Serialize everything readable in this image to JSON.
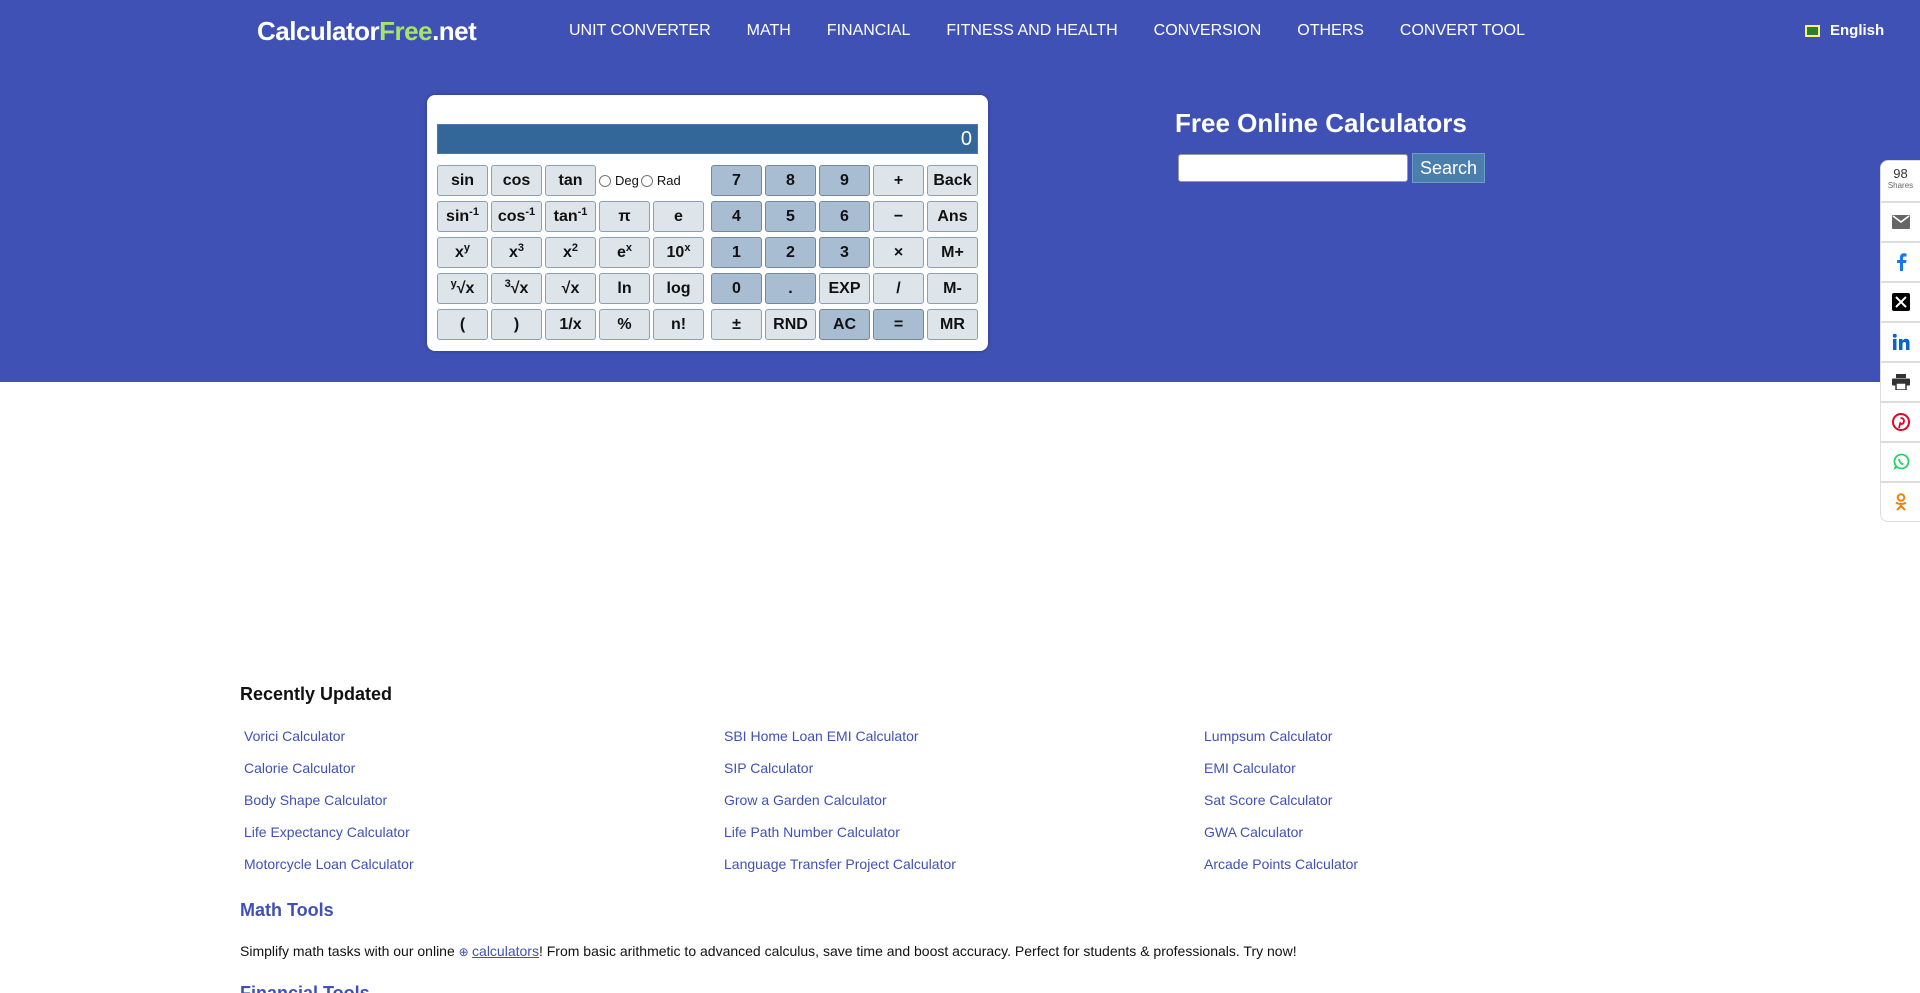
{
  "header": {
    "logo_main": "Calculator",
    "logo_free": "Free",
    "logo_tld": ".net",
    "nav": [
      "UNIT CONVERTER",
      "MATH",
      "FINANCIAL",
      "FITNESS AND HEALTH",
      "CONVERSION",
      "OTHERS",
      "CONVERT TOOL"
    ],
    "language": "English"
  },
  "calculator": {
    "display": "0",
    "deg_label": "Deg",
    "rad_label": "Rad"
  },
  "search": {
    "title": "Free Online Calculators",
    "button": "Search",
    "value": ""
  },
  "share": {
    "count": "98",
    "label": "Shares",
    "icons": [
      "email-icon",
      "facebook-icon",
      "x-icon",
      "linkedin-icon",
      "print-icon",
      "pinterest-icon",
      "whatsapp-icon",
      "odnoklassniki-icon"
    ],
    "colors": {
      "facebook": "#1877f2",
      "linkedin": "#0a66c2",
      "pinterest": "#e60023",
      "whatsapp": "#25d366",
      "ok": "#ee8208",
      "x": "#000000",
      "email": "#666666",
      "print": "#333333"
    }
  },
  "recent": {
    "title": "Recently Updated",
    "columns": [
      [
        "Vorici Calculator",
        "Calorie Calculator",
        "Body Shape Calculator",
        "Life Expectancy Calculator",
        "Motorcycle Loan Calculator"
      ],
      [
        "SBI Home Loan EMI Calculator",
        "SIP Calculator",
        "Grow a Garden Calculator",
        "Life Path Number Calculator",
        "Language Transfer Project Calculator"
      ],
      [
        "Lumpsum Calculator",
        "EMI Calculator",
        "Sat Score Calculator",
        "GWA Calculator",
        "Arcade Points Calculator"
      ]
    ]
  },
  "math_tools": {
    "title": "Math Tools",
    "text_before": "Simplify math tasks with our online ",
    "link": "calculators",
    "text_after": "! From basic arithmetic to advanced calculus, save time and boost accuracy. Perfect for students & professionals. Try now!"
  },
  "financial_tools": {
    "title": "Financial Tools"
  },
  "colors": {
    "brand": "#3f51b5",
    "display": "#336699",
    "logo_accent": "#a6e36a"
  }
}
